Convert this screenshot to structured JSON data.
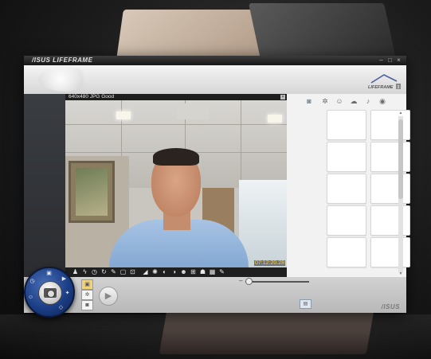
{
  "window": {
    "brand": "/ISUS",
    "title": "LIFEFRAME",
    "controls": {
      "minimize": "–",
      "restore": "□",
      "close": "×"
    }
  },
  "header": {
    "logo_text": "LIFEFRAME",
    "logo_version": "3"
  },
  "preview": {
    "info": "640x480  JPG  Good",
    "timestamp": "07:12:20.28",
    "toolbar_icons": [
      "person-icon",
      "flash-icon",
      "timer-icon",
      "rotate-icon",
      "pen-icon",
      "frame-icon",
      "edit-icon",
      "effect-icon",
      "brightness-icon",
      "contrast-icon",
      "color-icon",
      "face-icon",
      "border-icon",
      "photo-effect-icon",
      "image-icon",
      "settings-icon"
    ]
  },
  "gallery": {
    "tabs": [
      {
        "name": "camera-tab-icon",
        "glyph": "◙",
        "active": true
      },
      {
        "name": "settings-tab-icon",
        "glyph": "✲",
        "active": false
      },
      {
        "name": "face-tab-icon",
        "glyph": "☺",
        "active": false
      },
      {
        "name": "cloud-tab-icon",
        "glyph": "☁",
        "active": false
      },
      {
        "name": "mic-tab-icon",
        "glyph": "♪",
        "active": false
      },
      {
        "name": "eye-tab-icon",
        "glyph": "◉",
        "active": false
      }
    ],
    "thumbnail_count": 10
  },
  "controls": {
    "mode_buttons": [
      {
        "name": "photo-mode-button",
        "glyph": "▣",
        "active": true
      },
      {
        "name": "settings-mode-button",
        "glyph": "✲",
        "active": false
      },
      {
        "name": "record-mode-button",
        "glyph": "◙",
        "active": false
      }
    ],
    "play_glyph": "▶",
    "zoom_minus": "–",
    "zoom_level": 0.0,
    "small_button_glyph": "▤"
  },
  "footer": {
    "brand": "/ISUS"
  },
  "colors": {
    "accent_blue": "#1b3e86",
    "timestamp_yellow": "#ffcc33",
    "titlebar": "#161616"
  }
}
